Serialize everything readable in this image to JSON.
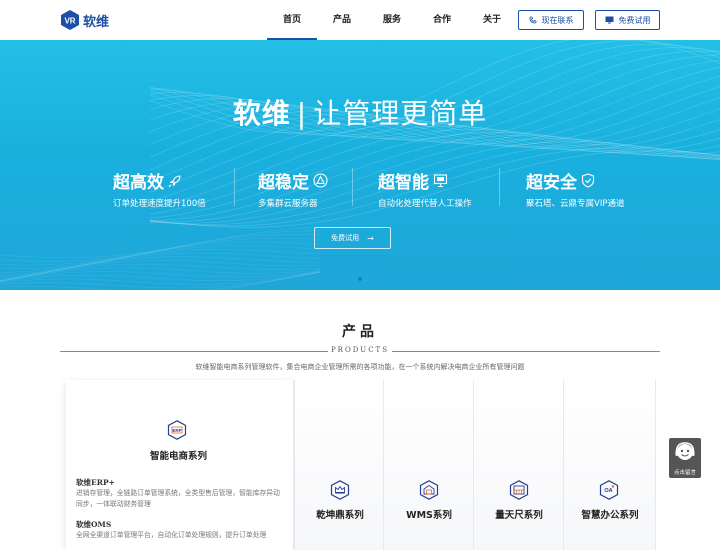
{
  "header": {
    "logo_text": "软维",
    "nav": [
      "首页",
      "产品",
      "服务",
      "合作",
      "关于"
    ],
    "contact_label": "现在联系",
    "trial_label": "免费试用"
  },
  "hero": {
    "title_brand": "软维",
    "title_sep": "|",
    "title_slogan": "让管理更简单",
    "features": [
      {
        "title": "超高效",
        "sub": "订单处理速度提升100倍",
        "icon": "rocket-icon"
      },
      {
        "title": "超稳定",
        "sub": "多集群云服务器",
        "icon": "stable-triangle-icon"
      },
      {
        "title": "超智能",
        "sub": "自动化处理代替人工操作",
        "icon": "computer-icon"
      },
      {
        "title": "超安全",
        "sub": "聚石塔、云鼎专属VIP通道",
        "icon": "shield-check-icon"
      }
    ],
    "cta_label": "免费试用",
    "cta_arrow": "→"
  },
  "products": {
    "title": "产品",
    "subtitle_en": "PRODUCTS",
    "desc": "软维智能电商系列管理软件，集合电商企业管理所需的各项功能，在一个系统内解决电商企业所有管理问题",
    "main_card": {
      "name": "智能电商系列",
      "icon": "erp-icon",
      "items": [
        {
          "title": "软维ERP+",
          "desc": "进销存管理，全链路订单管理系统，全类型售后管理，智能库存异动同步，一体联动财务管理"
        },
        {
          "title": "软维OMS",
          "desc": "全网全渠道订单管理平台，自动化订单处理规则，提升订单处理"
        }
      ]
    },
    "cards": [
      {
        "name": "乾坤鼎系列",
        "icon": "crown-icon"
      },
      {
        "name": "WMS系列",
        "icon": "warehouse-icon"
      },
      {
        "name": "量天尺系列",
        "icon": "ruler-icon"
      },
      {
        "name": "智慧办公系列",
        "icon": "oa-icon"
      }
    ]
  },
  "float_widget": {
    "label": "点击留言",
    "icon": "customer-service-icon"
  }
}
